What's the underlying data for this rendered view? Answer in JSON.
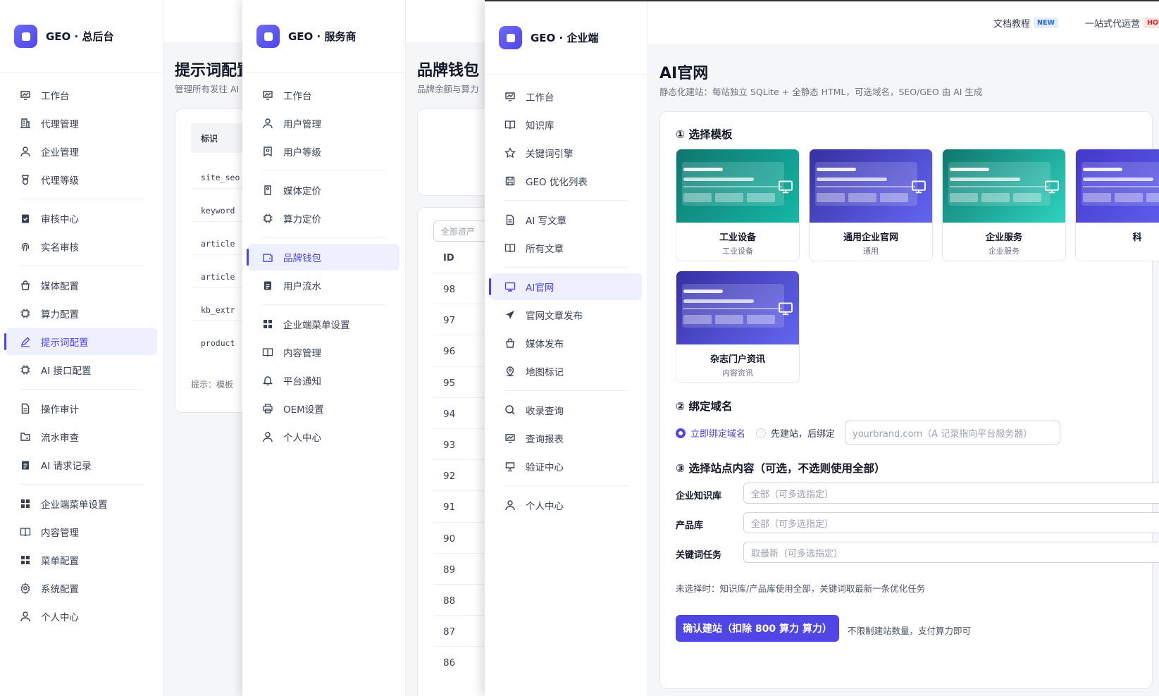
{
  "win1": {
    "brand": "GEO · 总后台",
    "nav": [
      {
        "label": "工作台",
        "icon": "chart-icon"
      },
      {
        "label": "代理管理",
        "icon": "building-icon"
      },
      {
        "label": "企业管理",
        "icon": "user-icon"
      },
      {
        "label": "代理等级",
        "icon": "medal-icon"
      },
      {
        "label": "审核中心",
        "icon": "check-clipboard-icon"
      },
      {
        "label": "实名审核",
        "icon": "fingerprint-icon"
      },
      {
        "label": "媒体配置",
        "icon": "bag-icon"
      },
      {
        "label": "算力配置",
        "icon": "chip-icon"
      },
      {
        "label": "提示词配置",
        "icon": "pen-icon",
        "active": true
      },
      {
        "label": "AI 接口配置",
        "icon": "chip-icon"
      },
      {
        "label": "操作审计",
        "icon": "document-icon"
      },
      {
        "label": "流水审查",
        "icon": "folder-icon"
      },
      {
        "label": "AI 请求记录",
        "icon": "clipboard-icon"
      },
      {
        "label": "企业端菜单设置",
        "icon": "grid-icon"
      },
      {
        "label": "内容管理",
        "icon": "book-icon"
      },
      {
        "label": "菜单配置",
        "icon": "grid-icon"
      },
      {
        "label": "系统配置",
        "icon": "gear-icon"
      },
      {
        "label": "个人中心",
        "icon": "user-icon"
      }
    ],
    "title": "提示词配置",
    "subtitle": "管理所有发往 AI",
    "table_header": "标识",
    "rows": [
      "site_seo",
      "keyword",
      "article",
      "article",
      "kb_extr",
      "product"
    ],
    "hint": "提示：模板"
  },
  "win2": {
    "brand": "GEO · 服务商",
    "nav": [
      {
        "label": "工作台",
        "icon": "chart-icon"
      },
      {
        "label": "用户管理",
        "icon": "user-icon"
      },
      {
        "label": "用户等级",
        "icon": "badge-icon"
      },
      {
        "label": "媒体定价",
        "icon": "tag-icon"
      },
      {
        "label": "算力定价",
        "icon": "chip-icon"
      },
      {
        "label": "品牌钱包",
        "icon": "wallet-icon",
        "active": true
      },
      {
        "label": "用户流水",
        "icon": "clipboard-icon"
      },
      {
        "label": "企业端菜单设置",
        "icon": "grid-icon"
      },
      {
        "label": "内容管理",
        "icon": "book-icon"
      },
      {
        "label": "平台通知",
        "icon": "bell-icon"
      },
      {
        "label": "OEM设置",
        "icon": "printer-icon"
      },
      {
        "label": "个人中心",
        "icon": "user-icon"
      }
    ],
    "title": "品牌钱包",
    "subtitle": "品牌余额与算力",
    "filter_placeholder": "全部资产",
    "id_header": "ID",
    "ids": [
      "98",
      "97",
      "96",
      "95",
      "94",
      "93",
      "92",
      "91",
      "90",
      "89",
      "88",
      "87",
      "86"
    ]
  },
  "win3": {
    "brand": "GEO · 企业端",
    "top_links": [
      {
        "label": "文档教程",
        "badge": "NEW"
      },
      {
        "label": "一站式代运营",
        "badge": "HO"
      }
    ],
    "nav": [
      {
        "label": "工作台",
        "icon": "chart-icon"
      },
      {
        "label": "知识库",
        "icon": "book-icon"
      },
      {
        "label": "关键词引擎",
        "icon": "star-icon"
      },
      {
        "label": "GEO 优化列表",
        "icon": "save-icon"
      },
      {
        "label": "AI 写文章",
        "icon": "document-icon"
      },
      {
        "label": "所有文章",
        "icon": "book-icon"
      },
      {
        "label": "AI官网",
        "icon": "monitor-icon",
        "active": true
      },
      {
        "label": "官网文章发布",
        "icon": "send-icon"
      },
      {
        "label": "媒体发布",
        "icon": "bag-icon"
      },
      {
        "label": "地图标记",
        "icon": "map-pin-icon"
      },
      {
        "label": "收录查询",
        "icon": "search-icon"
      },
      {
        "label": "查询报表",
        "icon": "chart-icon"
      },
      {
        "label": "验证中心",
        "icon": "shield-icon"
      },
      {
        "label": "个人中心",
        "icon": "user-icon"
      }
    ],
    "title": "AI官网",
    "subtitle": "静态化建站：每站独立 SQLite + 全静态 HTML，可选域名，SEO/GEO 由 AI 生成",
    "step1": "① 选择模板",
    "templates": [
      {
        "name": "工业设备",
        "sub": "工业设备",
        "c1": "#0f766e",
        "c2": "#14b8a6"
      },
      {
        "name": "通用企业官网",
        "sub": "通用",
        "c1": "#3730a3",
        "c2": "#6366f1"
      },
      {
        "name": "企业服务",
        "sub": "企业服务",
        "c1": "#0f766e",
        "c2": "#2dd4bf"
      },
      {
        "name": "科",
        "sub": "",
        "c1": "#4338ca",
        "c2": "#6366f1"
      },
      {
        "name": "杂志门户资讯",
        "sub": "内容资讯",
        "c1": "#3730a3",
        "c2": "#6366f1"
      }
    ],
    "step2": "② 绑定域名",
    "radio_now": "立即绑定域名",
    "radio_later": "先建站，后绑定",
    "domain_placeholder": "yourbrand.com（A 记录指向平台服务器）",
    "step3": "③ 选择站点内容（可选，不选则使用全部）",
    "kb_label": "企业知识库",
    "kb_placeholder": "全部（可多选指定）",
    "product_label": "产品库",
    "product_placeholder": "全部（可多选指定）",
    "kw_label": "关键词任务",
    "kw_placeholder": "取最新（可多选指定）",
    "note": "未选择时：知识库/产品库使用全部，关键词取最新一条优化任务",
    "confirm_button": "确认建站（扣除 800 算力 算力）",
    "confirm_note": "不限制建站数量，支付算力即可",
    "accent": "#4f46e5"
  }
}
